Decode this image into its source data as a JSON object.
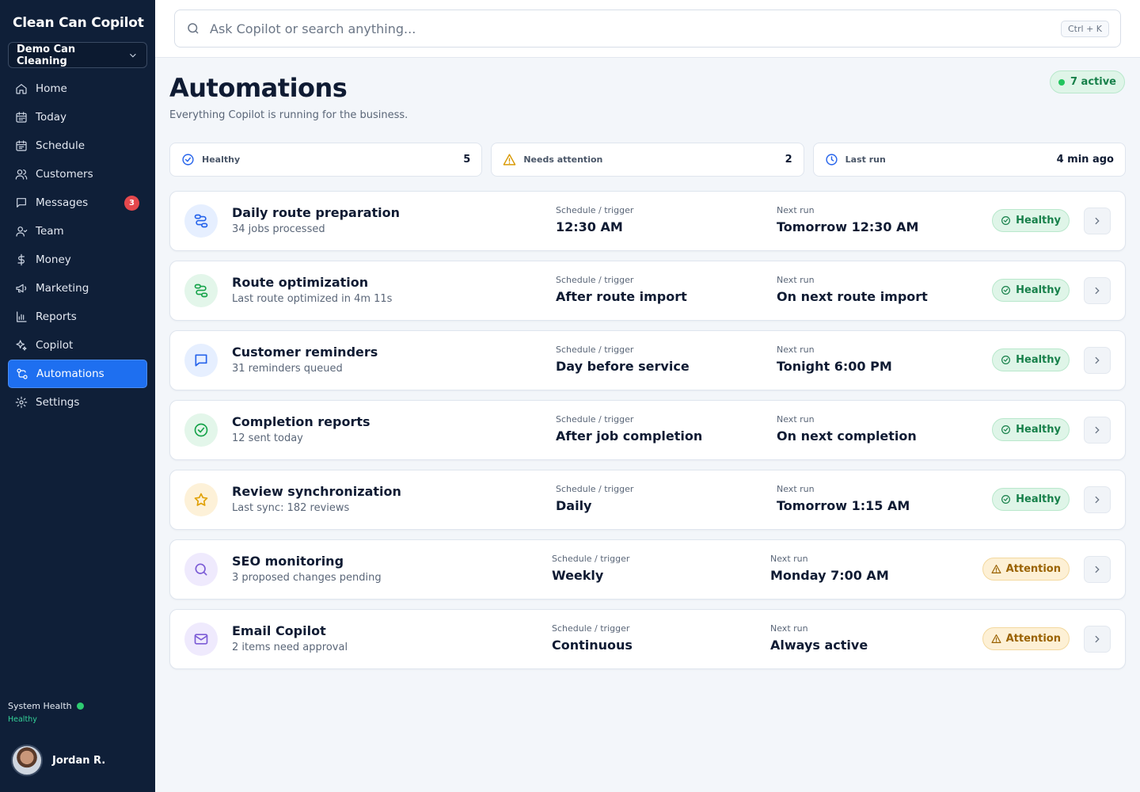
{
  "app": {
    "title": "Clean Can Copilot",
    "org": "Demo Can Cleaning"
  },
  "sidebar": {
    "items": [
      {
        "label": "Home",
        "icon": "home-icon"
      },
      {
        "label": "Today",
        "icon": "calendar-icon"
      },
      {
        "label": "Schedule",
        "icon": "schedule-icon"
      },
      {
        "label": "Customers",
        "icon": "customers-icon"
      },
      {
        "label": "Messages",
        "icon": "messages-icon",
        "badge": "3"
      },
      {
        "label": "Team",
        "icon": "team-icon"
      },
      {
        "label": "Money",
        "icon": "dollar-icon"
      },
      {
        "label": "Marketing",
        "icon": "megaphone-icon"
      },
      {
        "label": "Reports",
        "icon": "reports-icon"
      },
      {
        "label": "Copilot",
        "icon": "sparkle-icon"
      },
      {
        "label": "Automations",
        "icon": "automations-icon",
        "active": true
      },
      {
        "label": "Settings",
        "icon": "gear-icon"
      }
    ],
    "system_health_label": "System Health",
    "system_health_status": "Healthy",
    "user_name": "Jordan R."
  },
  "search": {
    "placeholder": "Ask Copilot or search anything...",
    "shortcut": "Ctrl + K"
  },
  "page": {
    "title": "Automations",
    "subtitle": "Everything Copilot is running for the business.",
    "active_count": "7 active"
  },
  "stats": [
    {
      "label": "Healthy",
      "value": "5",
      "icon": "check-circle-icon",
      "color": "#2563eb"
    },
    {
      "label": "Needs attention",
      "value": "2",
      "icon": "warning-icon",
      "color": "#d99a06"
    },
    {
      "label": "Last run",
      "value": "4 min ago",
      "icon": "clock-icon",
      "color": "#2563eb"
    }
  ],
  "columns": {
    "schedule": "Schedule / trigger",
    "next": "Next run"
  },
  "automations": [
    {
      "title": "Daily route preparation",
      "subtitle": "34 jobs processed",
      "schedule": "12:30 AM",
      "next": "Tomorrow 12:30 AM",
      "status": "Healthy",
      "icon": "route-icon",
      "icon_color": "#2563eb",
      "icon_bg": "#e6efff"
    },
    {
      "title": "Route optimization",
      "subtitle": "Last route optimized in 4m 11s",
      "schedule": "After route import",
      "next": "On next route import",
      "status": "Healthy",
      "icon": "route-icon",
      "icon_color": "#16a34a",
      "icon_bg": "#e3f6ea"
    },
    {
      "title": "Customer reminders",
      "subtitle": "31 reminders queued",
      "schedule": "Day before service",
      "next": "Tonight 6:00 PM",
      "status": "Healthy",
      "icon": "chat-icon",
      "icon_color": "#2563eb",
      "icon_bg": "#e6efff"
    },
    {
      "title": "Completion reports",
      "subtitle": "12 sent today",
      "schedule": "After job completion",
      "next": "On next completion",
      "status": "Healthy",
      "icon": "check-circle-icon",
      "icon_color": "#16a34a",
      "icon_bg": "#e3f6ea"
    },
    {
      "title": "Review synchronization",
      "subtitle": "Last sync: 182 reviews",
      "schedule": "Daily",
      "next": "Tomorrow 1:15 AM",
      "status": "Healthy",
      "icon": "star-icon",
      "icon_color": "#e0a106",
      "icon_bg": "#fdf1d8"
    },
    {
      "title": "SEO monitoring",
      "subtitle": "3 proposed changes pending",
      "schedule": "Weekly",
      "next": "Monday 7:00 AM",
      "status": "Attention",
      "icon": "search-icon",
      "icon_color": "#7c5cd6",
      "icon_bg": "#efeafd"
    },
    {
      "title": "Email Copilot",
      "subtitle": "2 items need approval",
      "schedule": "Continuous",
      "next": "Always active",
      "status": "Attention",
      "icon": "mail-icon",
      "icon_color": "#7c5cd6",
      "icon_bg": "#efeafd"
    }
  ]
}
